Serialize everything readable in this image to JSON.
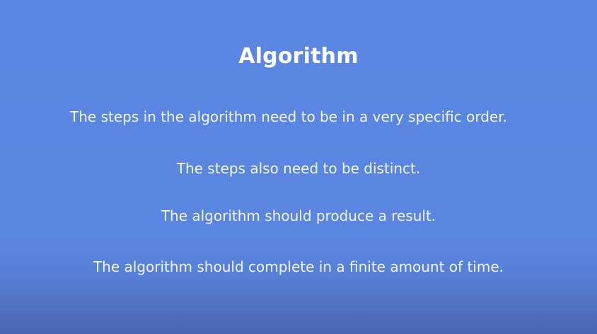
{
  "slide": {
    "title": "Algorithm",
    "lines": [
      "The steps in the algorithm need to be in a very specific order.",
      "The steps also need to be distinct.",
      "The algorithm should produce a result.",
      "The algorithm should complete in a finite amount of time."
    ]
  }
}
